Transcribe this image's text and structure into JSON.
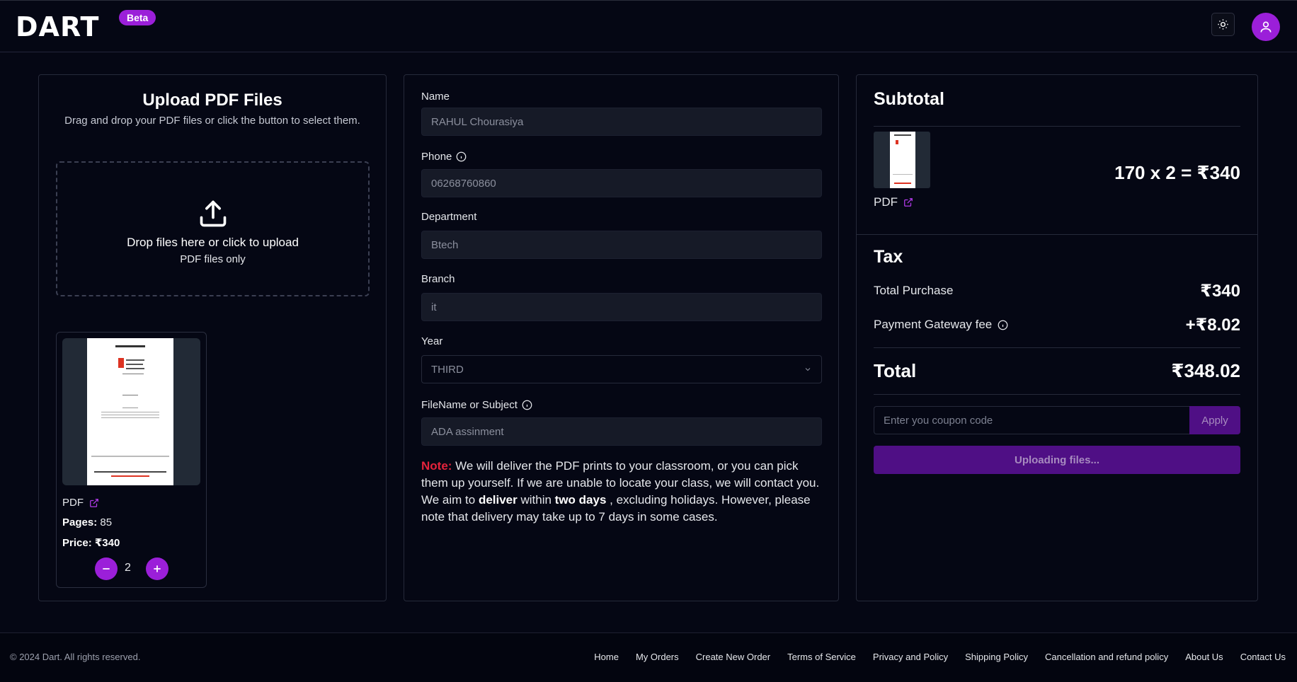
{
  "header": {
    "logo": "DART",
    "badge": "Beta",
    "theme_icon": "sun-icon",
    "avatar_icon": "user-icon"
  },
  "upload": {
    "title": "Upload PDF Files",
    "subtitle": "Drag and drop your PDF files or click the button to select them.",
    "drop_text": "Drop files here or click to upload",
    "drop_sub": "PDF files only",
    "file": {
      "type_label": "PDF",
      "pages_label": "Pages:",
      "pages": "85",
      "price_label": "Price:",
      "price": "₹340",
      "quantity": "2"
    }
  },
  "form": {
    "name_label": "Name",
    "name_value": "RAHUL Chourasiya",
    "phone_label": "Phone",
    "phone_value": "06268760860",
    "department_label": "Department",
    "department_value": "Btech",
    "branch_label": "Branch",
    "branch_value": "it",
    "year_label": "Year",
    "year_value": "THIRD",
    "subject_label": "FileName or Subject",
    "subject_value": "ADA assinment",
    "note": {
      "prefix": "Note:",
      "part1": " We will deliver the PDF prints to your classroom, or you can pick them up yourself. If we are unable to locate your class, we will contact you. We aim to ",
      "bold1": "deliver",
      "part2": " within ",
      "bold2": "two days",
      "part3": " , excluding holidays. However, please note that delivery may take up to 7 days in some cases."
    }
  },
  "summary": {
    "title": "Subtotal",
    "item_type": "PDF",
    "calc": "170 x 2 = ₹340",
    "tax_title": "Tax",
    "total_purchase_label": "Total Purchase",
    "total_purchase": "₹340",
    "gateway_label": "Payment Gateway fee",
    "gateway_fee": "+₹8.02",
    "total_label": "Total",
    "total": "₹348.02",
    "coupon_placeholder": "Enter you coupon code",
    "apply_label": "Apply",
    "upload_status": "Uploading files..."
  },
  "footer": {
    "copyright": "© 2024 Dart. All rights reserved.",
    "links": [
      "Home",
      "My Orders",
      "Create New Order",
      "Terms of Service",
      "Privacy and Policy",
      "Shipping Policy",
      "Cancellation and refund policy",
      "About Us",
      "Contact Us"
    ]
  },
  "colors": {
    "background": "#050714",
    "accent": "#9b1fd9",
    "accent_disabled": "#4f0f85",
    "note_red": "#e5233c"
  }
}
